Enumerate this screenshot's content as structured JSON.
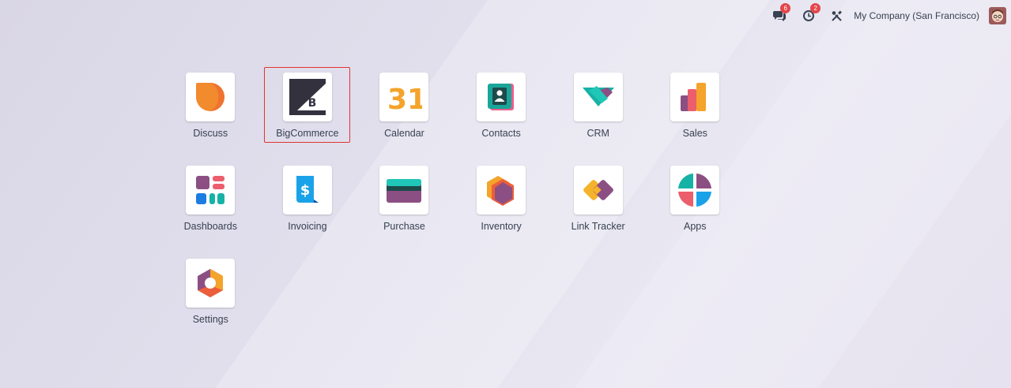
{
  "topbar": {
    "messages_count": "6",
    "activities_count": "2",
    "company": "My Company (San Francisco)"
  },
  "icons": {
    "messages": "chat-bubbles-icon",
    "activities": "clock-icon",
    "debug": "tools-icon"
  },
  "apps": [
    {
      "label": "Discuss",
      "icon": "discuss-icon"
    },
    {
      "label": "BigCommerce",
      "icon": "bigcommerce-icon",
      "selected": true
    },
    {
      "label": "Calendar",
      "icon": "calendar-icon",
      "icon_text": "31"
    },
    {
      "label": "Contacts",
      "icon": "contacts-icon"
    },
    {
      "label": "CRM",
      "icon": "crm-icon"
    },
    {
      "label": "Sales",
      "icon": "sales-icon"
    },
    {
      "label": "Dashboards",
      "icon": "dashboards-icon"
    },
    {
      "label": "Invoicing",
      "icon": "invoicing-icon",
      "icon_text": "$"
    },
    {
      "label": "Purchase",
      "icon": "purchase-icon"
    },
    {
      "label": "Inventory",
      "icon": "inventory-icon"
    },
    {
      "label": "Link Tracker",
      "icon": "link-tracker-icon"
    },
    {
      "label": "Apps",
      "icon": "apps-icon"
    },
    {
      "label": "Settings",
      "icon": "settings-icon"
    }
  ],
  "colors": {
    "badge": "#e4464a",
    "selection_border": "#e0342f",
    "label_text": "#374151"
  }
}
